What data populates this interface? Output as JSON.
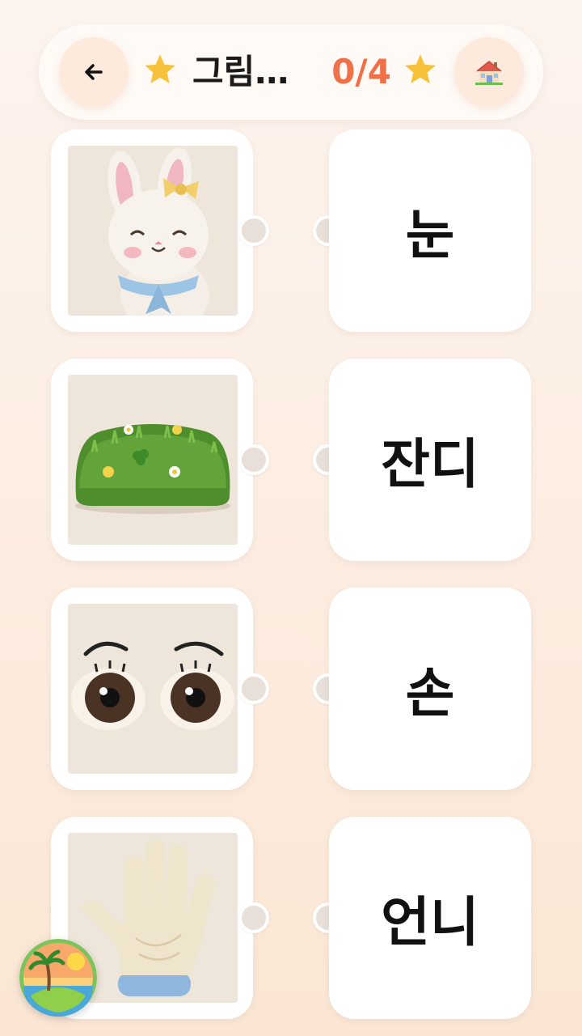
{
  "header": {
    "title": "그림…",
    "progress": "0/4",
    "back_icon": "arrow-left-icon",
    "home_icon": "house-icon",
    "star_color": "#f7c13a",
    "progress_color": "#f07048"
  },
  "pictures": [
    {
      "name": "felt-bunny"
    },
    {
      "name": "felt-grass"
    },
    {
      "name": "felt-eyes"
    },
    {
      "name": "felt-hand"
    }
  ],
  "words": [
    {
      "label": "눈"
    },
    {
      "label": "잔디"
    },
    {
      "label": "손"
    },
    {
      "label": "언니"
    }
  ],
  "badge": {
    "icon": "island-sunset-icon"
  }
}
